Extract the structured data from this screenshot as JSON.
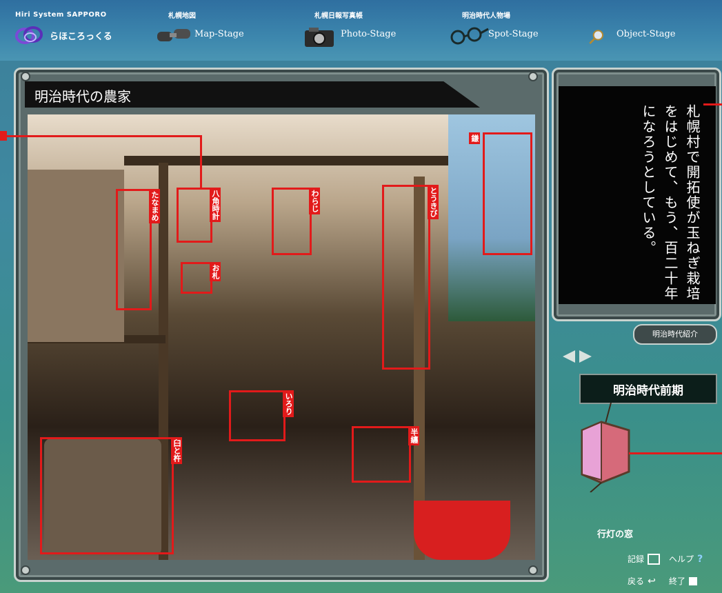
{
  "brand": {
    "small_title": "Hiri System SAPPORO",
    "name": "らほころっくる"
  },
  "stages": [
    {
      "caption": "札幌地図",
      "label": "Map-Stage",
      "icon": "binoculars-icon"
    },
    {
      "caption": "札幌日報写真帳",
      "label": "Photo-Stage",
      "icon": "camera-icon"
    },
    {
      "caption": "明治時代人物場",
      "label": "Spot-Stage",
      "icon": "glasses-icon"
    },
    {
      "caption": "",
      "label": "Object-Stage",
      "icon": "magnifier-icon"
    }
  ],
  "main": {
    "title": "明治時代の農家",
    "annotations": [
      "たなまめ",
      "八角時計",
      "わらじ",
      "とうきび",
      "お札",
      "いろり",
      "半纏",
      "臼と杵",
      "鎌"
    ]
  },
  "side": {
    "text": "札幌村で開拓使が玉ねぎ栽培をはじめて、もう、百二十年になろうとしている。",
    "intro_button": "明治時代紹介",
    "era": "明治時代前期",
    "object_caption": "行灯の窓"
  },
  "controls": {
    "record": "記録",
    "help": "ヘルプ",
    "back": "戻る",
    "exit": "終了"
  },
  "colors": {
    "accent_red": "#e21a1a",
    "panel_black": "#050505",
    "frame_gray": "#5b6b6b"
  }
}
